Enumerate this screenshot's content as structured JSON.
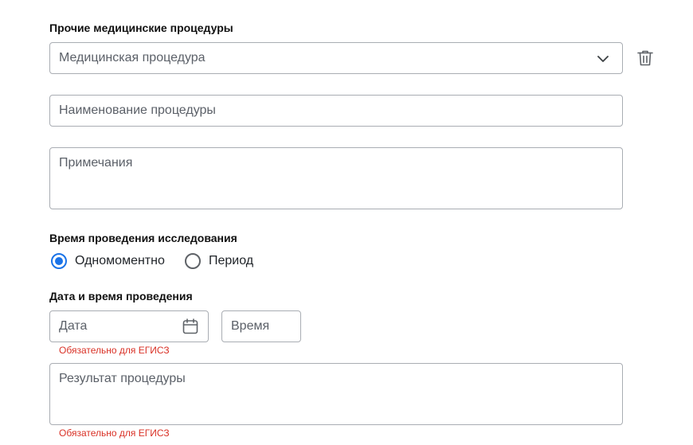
{
  "section_title": "Прочие медицинские процедуры",
  "procedure_select": {
    "value": "Медицинская процедура",
    "icon": "chevron-down-icon"
  },
  "delete_icon": "trash-icon",
  "procedure_name": {
    "placeholder": "Наименование процедуры"
  },
  "notes": {
    "placeholder": "Примечания"
  },
  "time_section": {
    "title": "Время проведения исследования",
    "options": [
      {
        "label": "Одномоментно",
        "selected": true
      },
      {
        "label": "Период",
        "selected": false
      }
    ]
  },
  "datetime_section": {
    "title": "Дата и время проведения",
    "date_placeholder": "Дата",
    "time_placeholder": "Время",
    "required_hint": "Обязательно для ЕГИСЗ"
  },
  "result": {
    "placeholder": "Результат процедуры",
    "required_hint": "Обязательно для ЕГИСЗ"
  },
  "colors": {
    "accent": "#1a73e8",
    "error": "#d93025",
    "border": "#a9adb3"
  }
}
